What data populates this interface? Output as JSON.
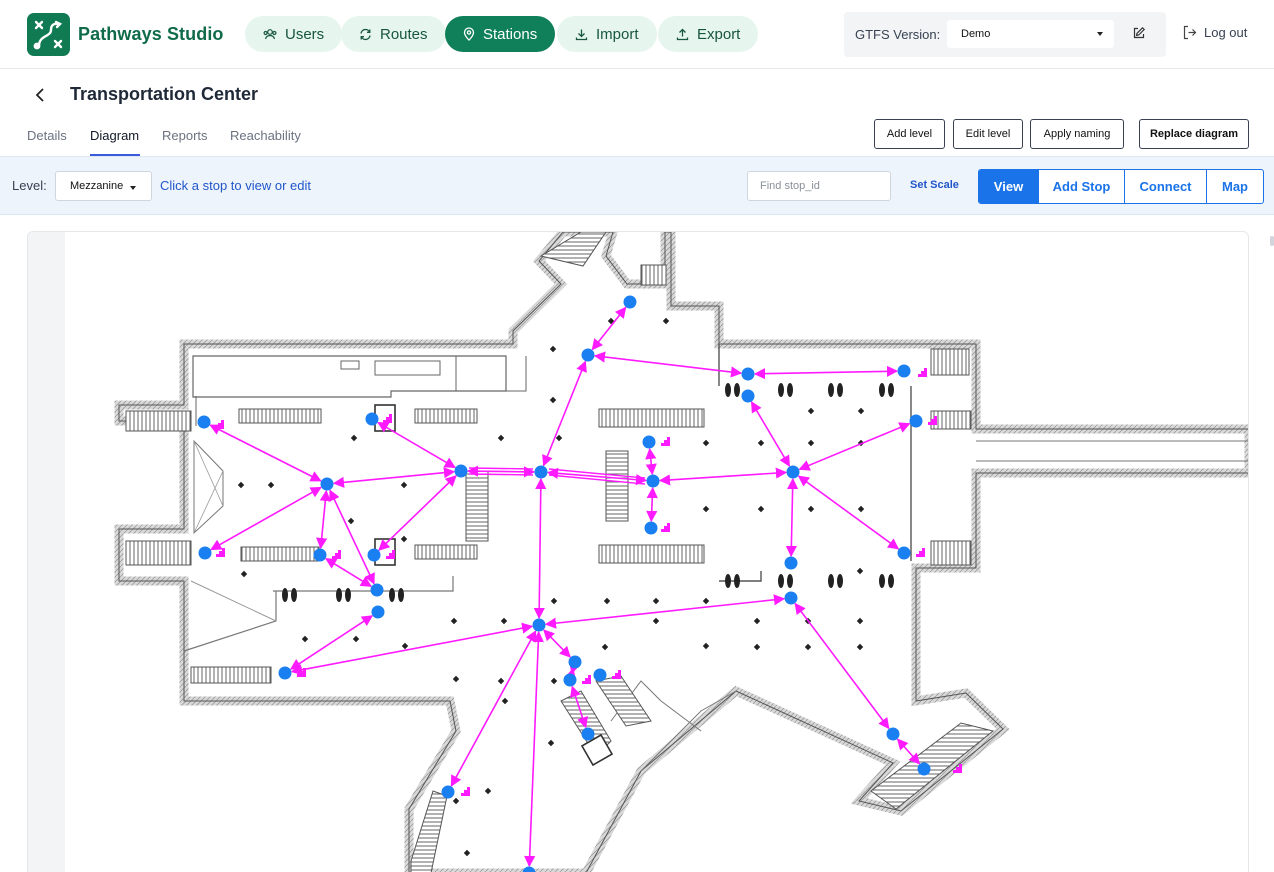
{
  "app": {
    "name": "Pathways Studio"
  },
  "nav": {
    "items": [
      {
        "label": "Users",
        "icon": "users-icon"
      },
      {
        "label": "Routes",
        "icon": "refresh-icon"
      },
      {
        "label": "Stations",
        "icon": "map-pin-icon",
        "active": true
      },
      {
        "label": "Import",
        "icon": "download-icon"
      },
      {
        "label": "Export",
        "icon": "upload-icon"
      }
    ]
  },
  "gtfs": {
    "label": "GTFS Version:",
    "value": "Demo"
  },
  "account": {
    "logout_label": "Log out"
  },
  "station": {
    "title": "Transportation Center"
  },
  "tabs": [
    {
      "label": "Details"
    },
    {
      "label": "Diagram",
      "active": true
    },
    {
      "label": "Reports"
    },
    {
      "label": "Reachability"
    }
  ],
  "actions": {
    "add_level": "Add level",
    "edit_level": "Edit level",
    "apply_naming": "Apply naming",
    "replace_diagram": "Replace diagram"
  },
  "level_toolbar": {
    "level_label": "Level:",
    "level_value": "Mezzanine",
    "hint": "Click a stop to view or edit",
    "find_placeholder": "Find stop_id",
    "set_scale": "Set Scale",
    "modes": [
      "View",
      "Add Stop",
      "Connect",
      "Map"
    ],
    "active_mode": "View"
  },
  "colors": {
    "brand": "#107a52",
    "accent": "#1a73e8",
    "stop": "#1a7ff0",
    "pathway": "#ff1aff",
    "wall": "#7a7a7a"
  }
}
